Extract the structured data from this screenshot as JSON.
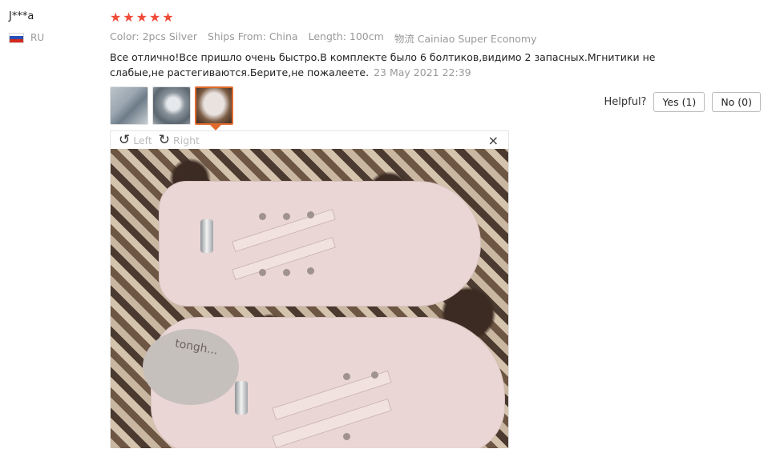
{
  "reviewer": {
    "name": "J***a",
    "country": "RU"
  },
  "rating": {
    "stars": 5,
    "star_glyph": "★"
  },
  "attributes": [
    {
      "text": "Color: 2pcs Silver"
    },
    {
      "text": "Ships From: China"
    },
    {
      "text": "Length: 100cm"
    },
    {
      "text": "物流 Cainiao Super Economy"
    }
  ],
  "review": {
    "text": "Все отлично!Все пришло очень быстро.В комплекте было 6 болтиков,видимо 2 запасных.Мгнитики не слабые,не растегиваются.Берите,не пожалеете.",
    "date": "23 May 2021 22:39"
  },
  "helpful": {
    "label": "Helpful?",
    "yes_label": "Yes (1)",
    "no_label": "No (0)"
  },
  "viewer": {
    "left_label": "Left",
    "right_label": "Right",
    "close_glyph": "×",
    "rotate_left_glyph": "↺",
    "rotate_right_glyph": "↻",
    "photo_text": "tongh..."
  },
  "colors": {
    "star": "#f04a39",
    "active_thumb": "#e06a2d"
  }
}
